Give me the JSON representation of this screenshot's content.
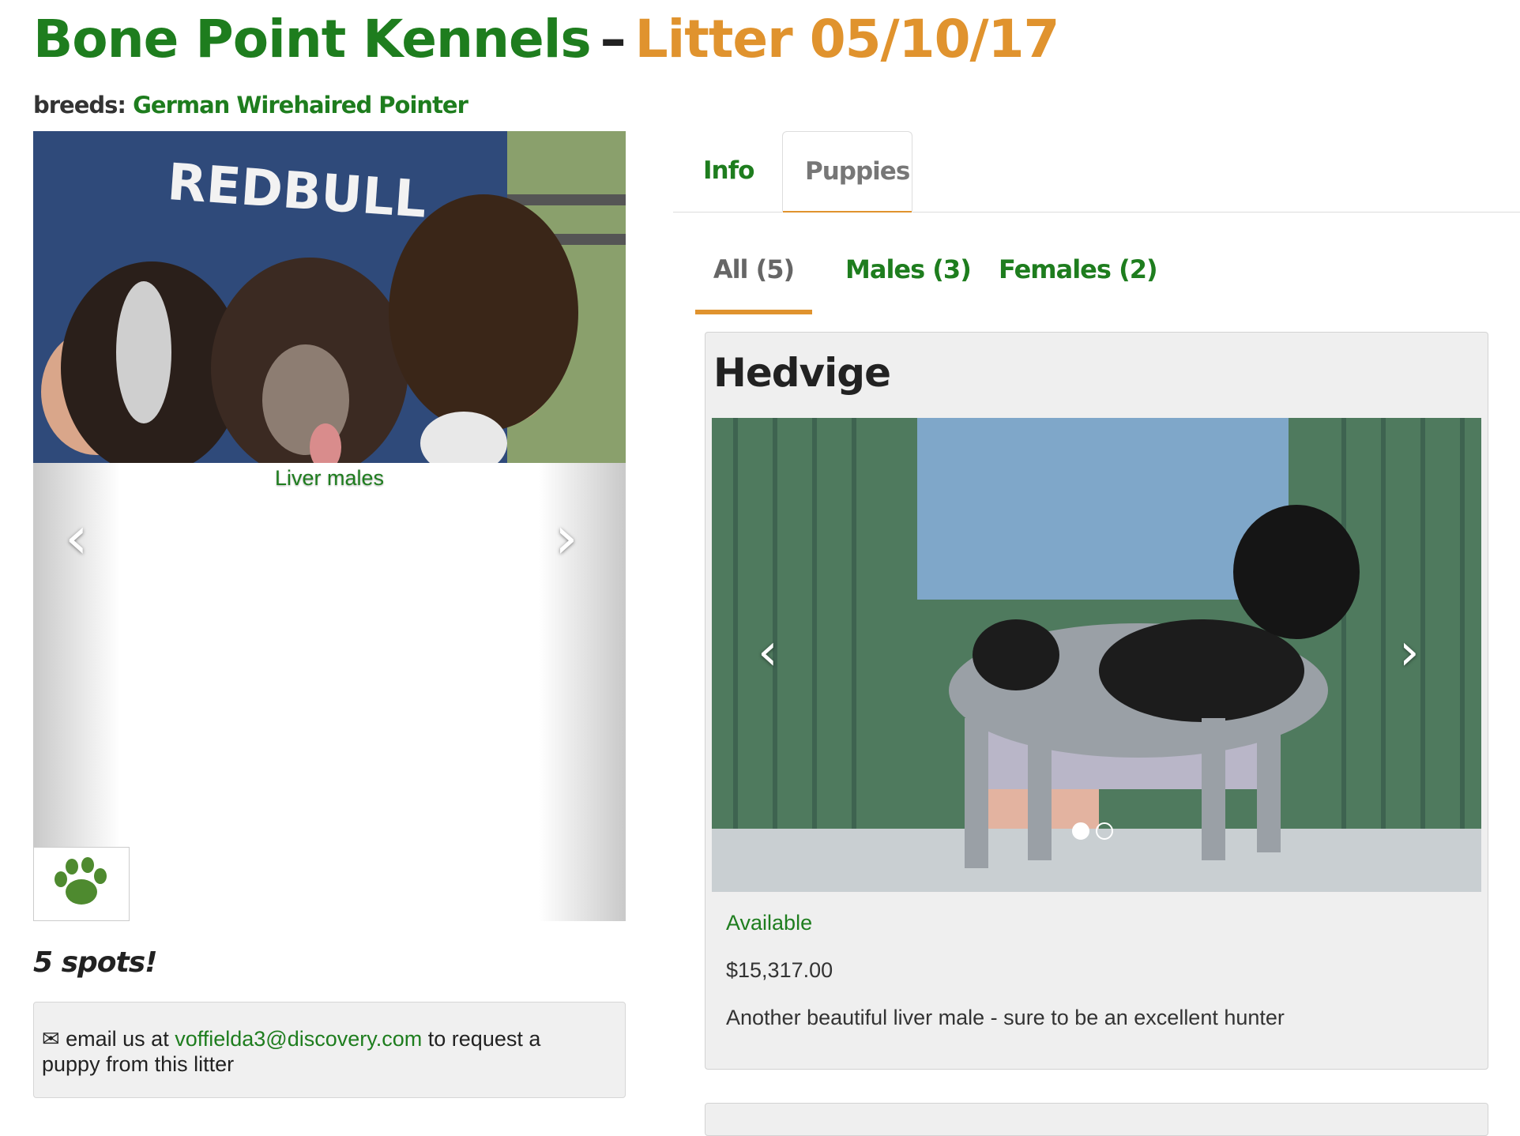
{
  "header": {
    "kennel_name": "Bone Point Kennels",
    "separator": "–",
    "litter_title": "Litter 05/10/17"
  },
  "breeds": {
    "label": "breeds:",
    "value": "German Wirehaired Pointer"
  },
  "litter_carousel": {
    "caption": "Liver males",
    "prev_icon": "‹",
    "next_icon": "›",
    "thumbnail_icon": "paw-icon"
  },
  "spots": "5 spots!",
  "contact": {
    "icon": "envelope-icon",
    "prefix": "email us at",
    "email": "voffielda3@discovery.com",
    "suffix": "to request a puppy from this litter"
  },
  "tabs": [
    {
      "label": "Info",
      "active": false
    },
    {
      "label": "Puppies",
      "active": true
    }
  ],
  "subtabs": [
    {
      "label": "All (5)",
      "active": true
    },
    {
      "label": "Males (3)",
      "active": false
    },
    {
      "label": "Females (2)",
      "active": false
    }
  ],
  "puppy": {
    "name": "Hedvige",
    "status": "Available",
    "price": "$15,317.00",
    "description": "Another beautiful liver male - sure to be an excellent hunter",
    "photo_count": 2,
    "active_photo": 1
  },
  "colors": {
    "brand_green": "#1e7d1e",
    "accent_orange": "#e0932e"
  }
}
